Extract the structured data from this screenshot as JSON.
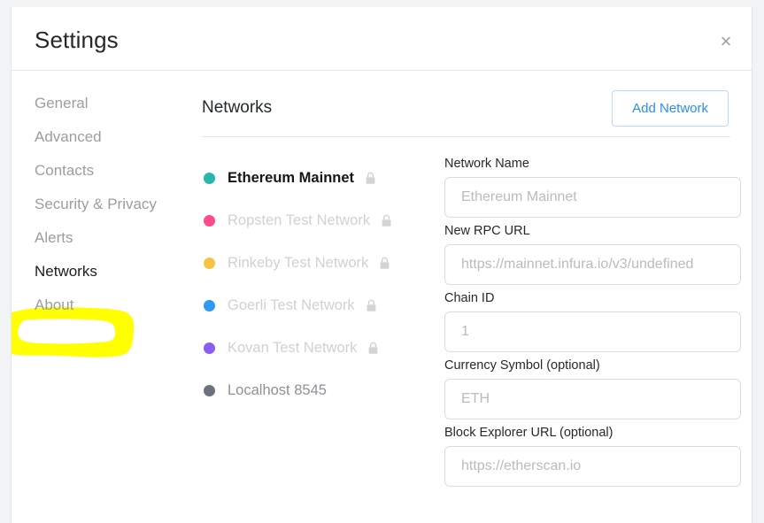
{
  "window": {
    "title": "Settings",
    "close_label": "×",
    "close_icon": "close-icon"
  },
  "sidebar": {
    "items": [
      {
        "label": "General",
        "active": false
      },
      {
        "label": "Advanced",
        "active": false
      },
      {
        "label": "Contacts",
        "active": false
      },
      {
        "label": "Security & Privacy",
        "active": false
      },
      {
        "label": "Alerts",
        "active": false
      },
      {
        "label": "Networks",
        "active": true
      },
      {
        "label": "About",
        "active": false
      }
    ]
  },
  "annotation": {
    "type": "highlighter-stroke",
    "target": "Networks",
    "color": "#FFFF00"
  },
  "content": {
    "title": "Networks",
    "add_network_label": "Add Network"
  },
  "networks": [
    {
      "name": "Ethereum Mainnet",
      "color": "#29b6af",
      "locked": true,
      "selected": true,
      "lock_icon": "lock-icon"
    },
    {
      "name": "Ropsten Test Network",
      "color": "#ff4a8d",
      "locked": true,
      "selected": false,
      "lock_icon": "lock-icon"
    },
    {
      "name": "Rinkeby Test Network",
      "color": "#f6c343",
      "locked": true,
      "selected": false,
      "lock_icon": "lock-icon"
    },
    {
      "name": "Goerli Test Network",
      "color": "#3099f2",
      "locked": true,
      "selected": false,
      "lock_icon": "lock-icon"
    },
    {
      "name": "Kovan Test Network",
      "color": "#8a5cf5",
      "locked": true,
      "selected": false,
      "lock_icon": "lock-icon"
    },
    {
      "name": "Localhost 8545",
      "color": "#6a737d",
      "locked": false,
      "selected": false,
      "lock_icon": ""
    }
  ],
  "form": {
    "fields": [
      {
        "label": "Network Name",
        "value": "",
        "placeholder": "Ethereum Mainnet"
      },
      {
        "label": "New RPC URL",
        "value": "",
        "placeholder": "https://mainnet.infura.io/v3/undefined"
      },
      {
        "label": "Chain ID",
        "value": "",
        "placeholder": "1"
      },
      {
        "label": "Currency Symbol (optional)",
        "value": "",
        "placeholder": "ETH"
      },
      {
        "label": "Block Explorer URL (optional)",
        "value": "",
        "placeholder": "https://etherscan.io"
      }
    ]
  },
  "colors": {
    "accent": "#2a8ff0",
    "highlight": "#FFFF00",
    "text": "#24292e",
    "muted": "#9a9da2"
  }
}
